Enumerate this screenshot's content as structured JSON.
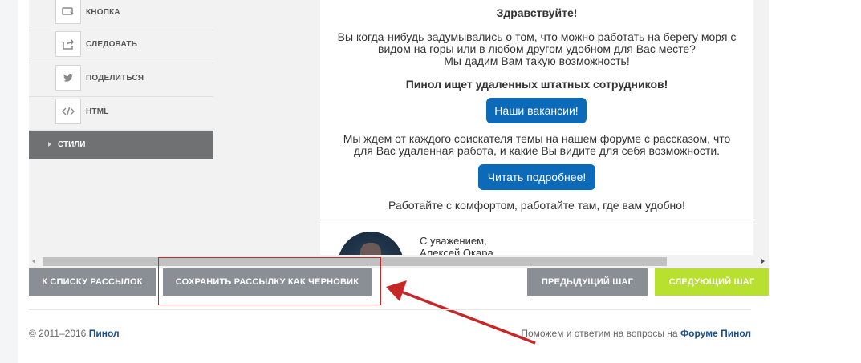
{
  "sidebar": {
    "items": [
      {
        "label": "КНОПКА",
        "icon": "button-icon"
      },
      {
        "label": "СЛЕДОВАТЬ",
        "icon": "share-icon"
      },
      {
        "label": "ПОДЕЛИТЬСЯ",
        "icon": "twitter-icon"
      },
      {
        "label": "HTML",
        "icon": "code-icon"
      }
    ],
    "styles_label": "СТИЛИ"
  },
  "letter": {
    "greeting": "Здравствуйте!",
    "para1_line1": "Вы когда-нибудь задумывались о том, что можно работать на берегу моря с",
    "para1_line2": "видом на горы или в любом другом удобном для Вас месте?",
    "para1_line3": "Мы дадим Вам такую возможность!",
    "headline": "Пинол ищет удаленных штатных сотрудников!",
    "vacancies_button": "Наши вакансии!",
    "para2_line1": "Мы ждем от каждого соискателя темы на нашем форуме с рассказом, что",
    "para2_line2": "для Вас удаленная работа, и какие Вы видите для себя возможности.",
    "read_more_button": "Читать подробнее!",
    "closing": "Работайте с комфортом, работайте там, где вам удобно!",
    "sign_line1": "С уважением,",
    "sign_line2": "Алексей Окара"
  },
  "actions": {
    "back_to_list": "К СПИСКУ РАССЫЛОК",
    "save_draft": "СОХРАНИТЬ РАССЫЛКУ КАК ЧЕРНОВИК",
    "prev_step": "ПРЕДЫДУЩИЙ ШАГ",
    "next_step": "СЛЕДУЮЩИЙ ШАГ"
  },
  "footer": {
    "copyright": "© 2011–2016 ",
    "brand": "Пинол",
    "help_text": "Поможем и ответим на вопросы на ",
    "forum_link": "Форуме Пинол"
  },
  "colors": {
    "primary_button": "#0d6ab8",
    "next_button": "#b8e02e",
    "annotation_red": "#c62828"
  }
}
